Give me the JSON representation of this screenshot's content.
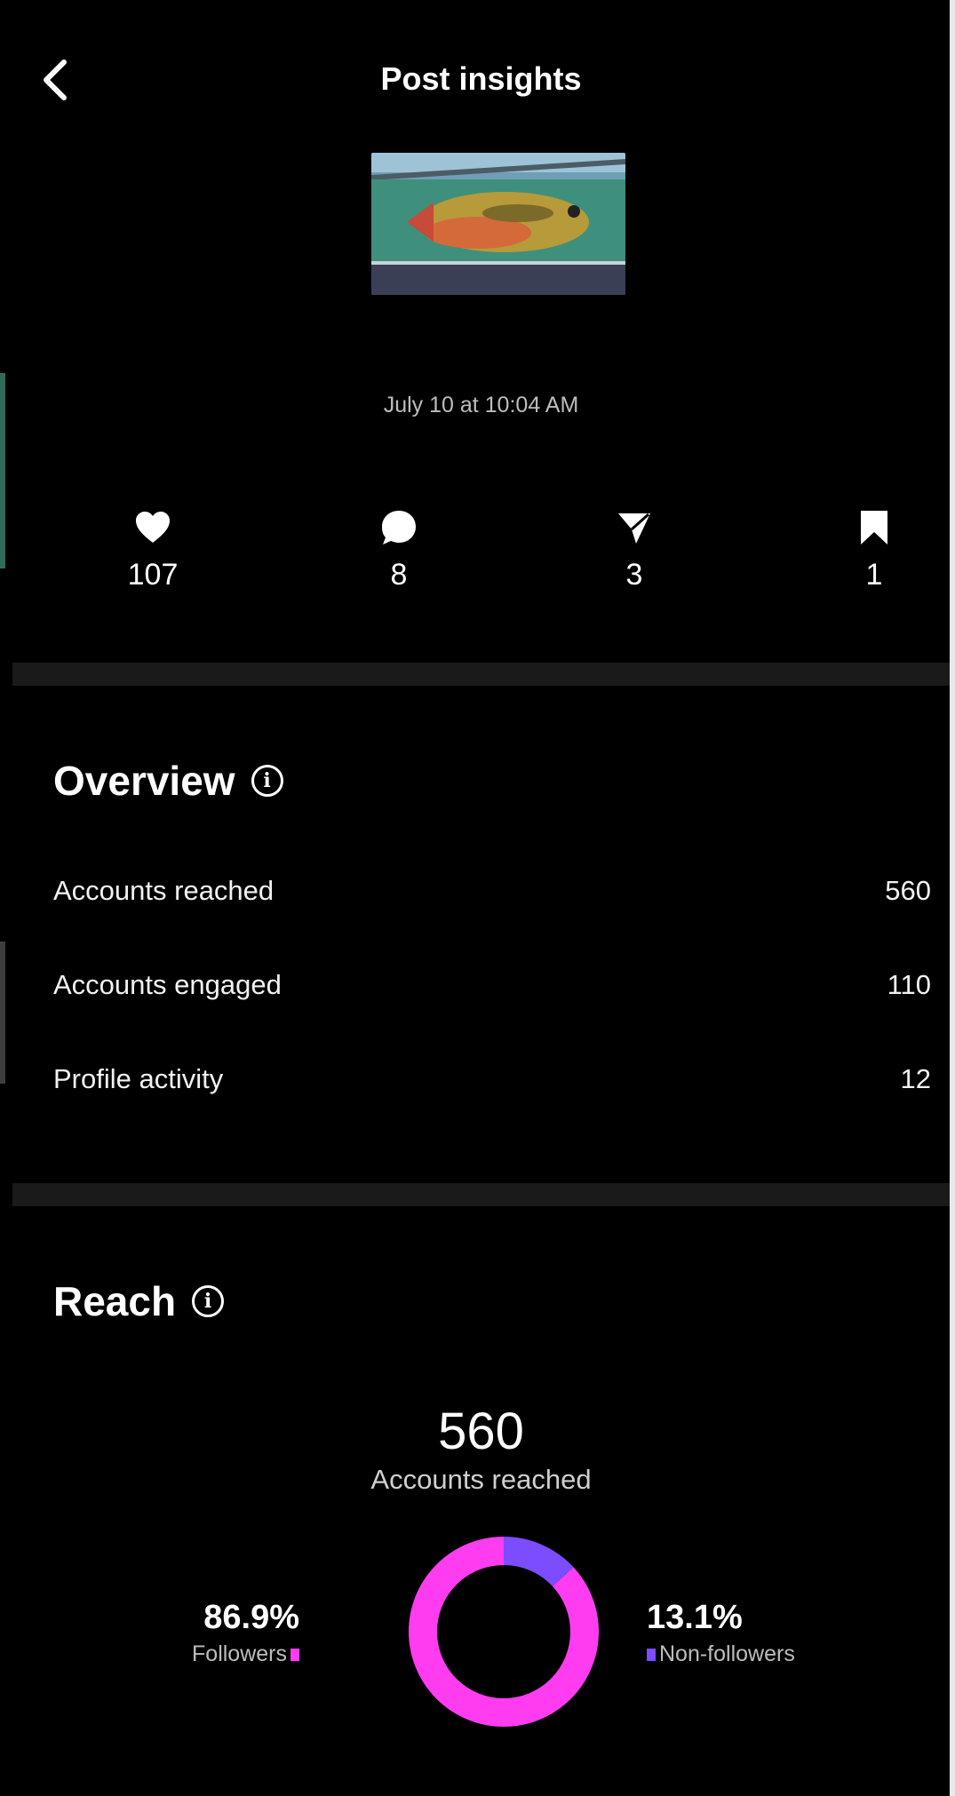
{
  "header": {
    "title": "Post insights"
  },
  "post": {
    "date": "July 10 at 10:04 AM"
  },
  "stats": [
    {
      "icon": "heart-icon",
      "value": "107"
    },
    {
      "icon": "comment-icon",
      "value": "8"
    },
    {
      "icon": "share-icon",
      "value": "3"
    },
    {
      "icon": "bookmark-icon",
      "value": "1"
    }
  ],
  "overview": {
    "title": "Overview",
    "rows": [
      {
        "label": "Accounts reached",
        "value": "560"
      },
      {
        "label": "Accounts engaged",
        "value": "110"
      },
      {
        "label": "Profile activity",
        "value": "12"
      }
    ]
  },
  "reach": {
    "title": "Reach",
    "total": "560",
    "total_label": "Accounts reached",
    "followers": {
      "percent": "86.9%",
      "label": "Followers",
      "fraction": 0.869,
      "color": "#ff3cf0"
    },
    "non_followers": {
      "percent": "13.1%",
      "label": "Non-followers",
      "fraction": 0.131,
      "color": "#7b4dff"
    }
  }
}
